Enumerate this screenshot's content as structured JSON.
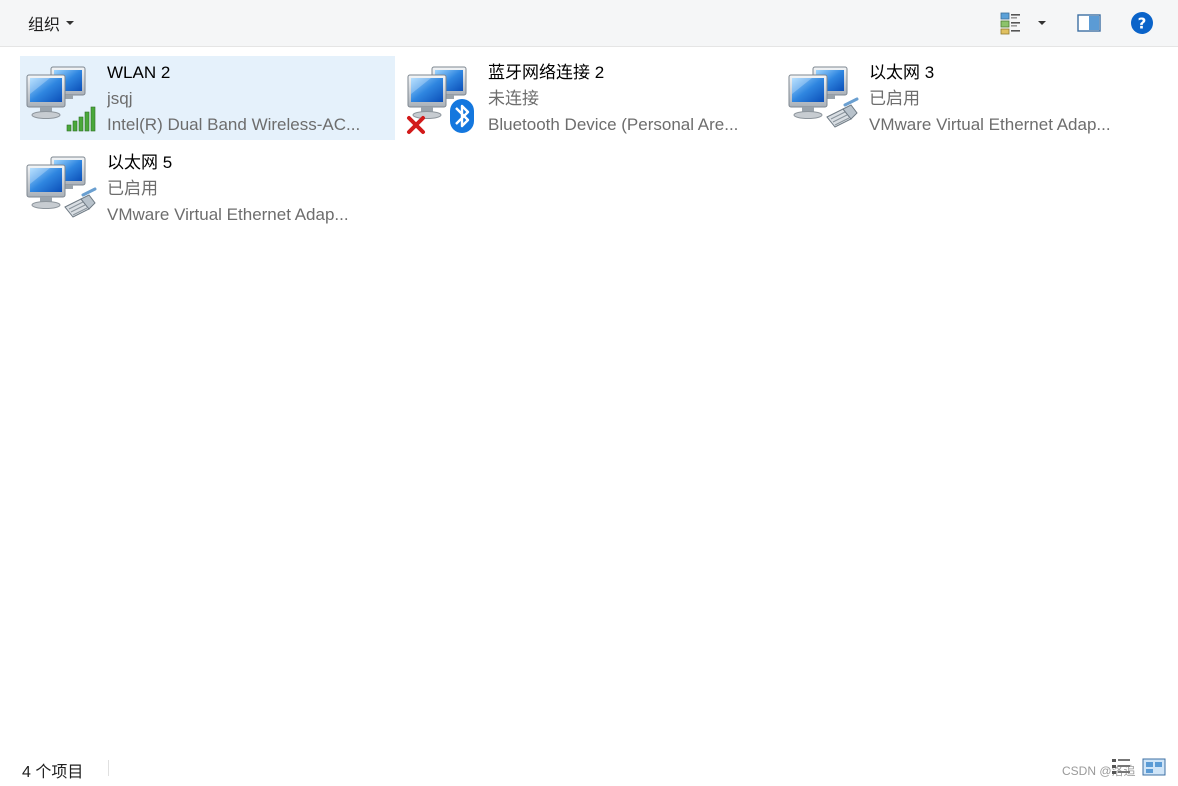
{
  "toolbar": {
    "organize_label": "组织",
    "icons": {
      "view": "view-options-icon",
      "preview_pane": "preview-pane-icon",
      "help": "help-icon"
    },
    "help_glyph": "?",
    "help_color": "#0a63c9"
  },
  "items": [
    {
      "name": "WLAN 2",
      "status": "jsqj",
      "device": "Intel(R) Dual Band Wireless-AC...",
      "icon": "wireless-network-icon",
      "selected": true
    },
    {
      "name": "蓝牙网络连接 2",
      "status": "未连接",
      "device": "Bluetooth Device (Personal Are...",
      "icon": "bluetooth-network-icon",
      "selected": false
    },
    {
      "name": "以太网 3",
      "status": "已启用",
      "device": "VMware Virtual Ethernet Adap...",
      "icon": "ethernet-network-icon",
      "selected": false
    },
    {
      "name": "以太网 5",
      "status": "已启用",
      "device": "VMware Virtual Ethernet Adap...",
      "icon": "ethernet-network-icon",
      "selected": false
    }
  ],
  "statusbar": {
    "item_count": "4 个项目",
    "watermark": "CSDN @洛追"
  },
  "colors": {
    "selection": "#e5f1fb",
    "toolbar_bg": "#f5f6f7",
    "secondary_text": "#6d6d6d"
  }
}
